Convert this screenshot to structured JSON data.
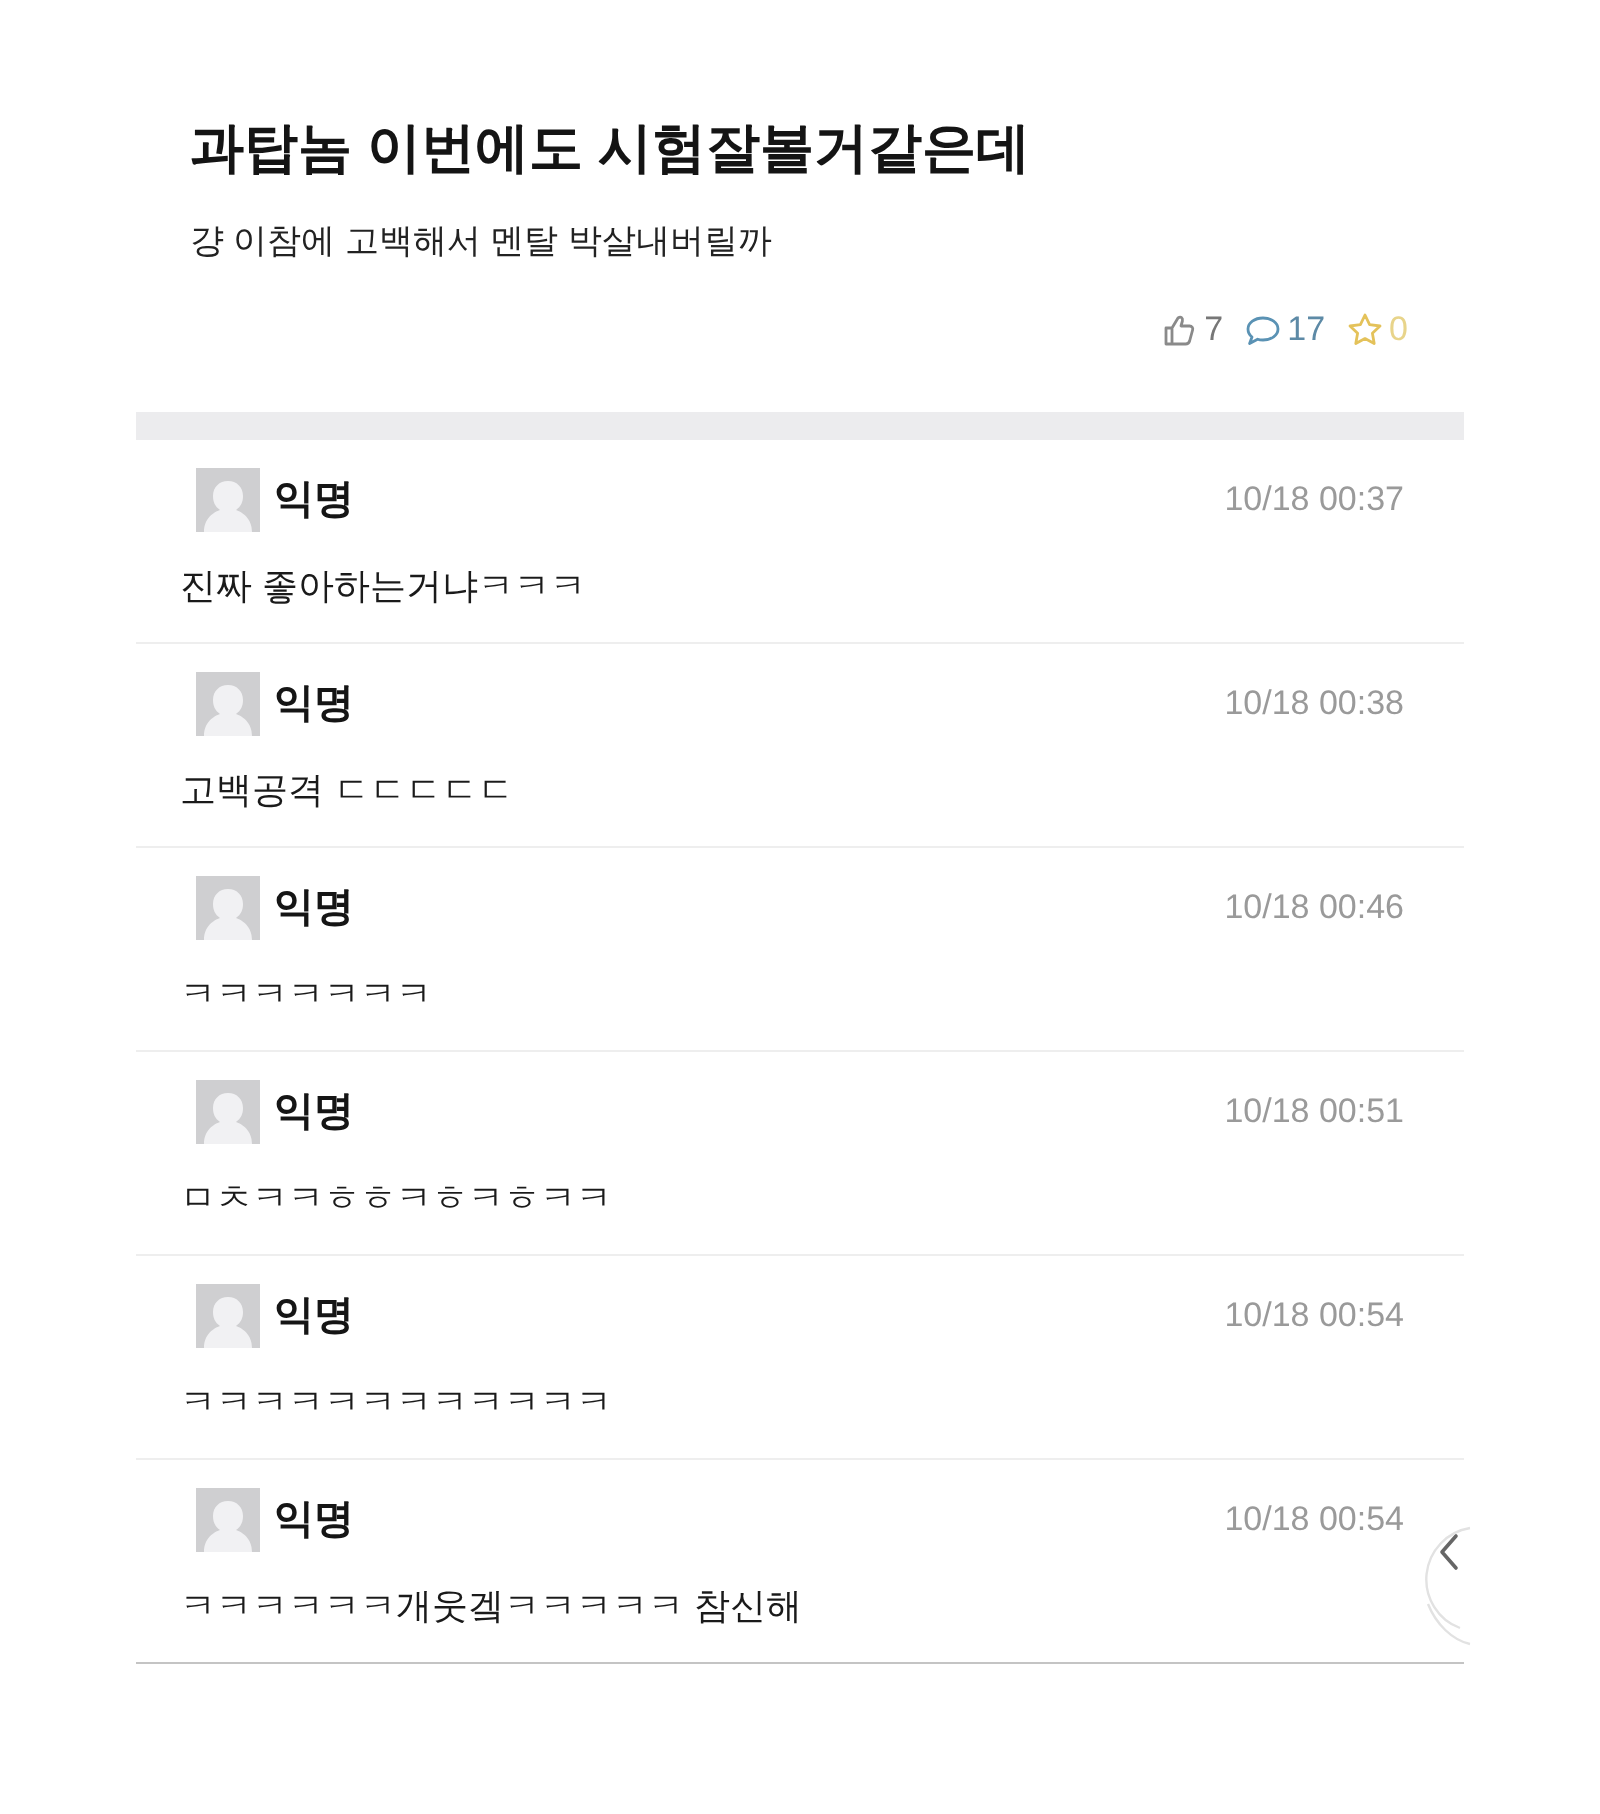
{
  "post": {
    "title": "과탑놈 이번에도 시험잘볼거같은데",
    "body": "걍 이참에 고백해서 멘탈 박살내버릴까",
    "stats": [
      {
        "kind": "like",
        "count": "7"
      },
      {
        "kind": "comment",
        "count": "17"
      },
      {
        "kind": "scrap",
        "count": "0"
      }
    ]
  },
  "comments": [
    {
      "author": "익명",
      "time": "10/18 00:37",
      "text": "진짜 좋아하는거냐ㅋㅋㅋ"
    },
    {
      "author": "익명",
      "time": "10/18 00:38",
      "text": "고백공격 ㄷㄷㄷㄷㄷ"
    },
    {
      "author": "익명",
      "time": "10/18 00:46",
      "text": "ㅋㅋㅋㅋㅋㅋㅋ"
    },
    {
      "author": "익명",
      "time": "10/18 00:51",
      "text": "ㅁㅊㅋㅋㅎㅎㅋㅎㅋㅎㅋㅋ"
    },
    {
      "author": "익명",
      "time": "10/18 00:54",
      "text": "ㅋㅋㅋㅋㅋㅋㅋㅋㅋㅋㅋㅋ"
    },
    {
      "author": "익명",
      "time": "10/18 00:54",
      "text": "ㅋㅋㅋㅋㅋㅋ개웃겤ㅋㅋㅋㅋㅋ 참신해"
    }
  ]
}
